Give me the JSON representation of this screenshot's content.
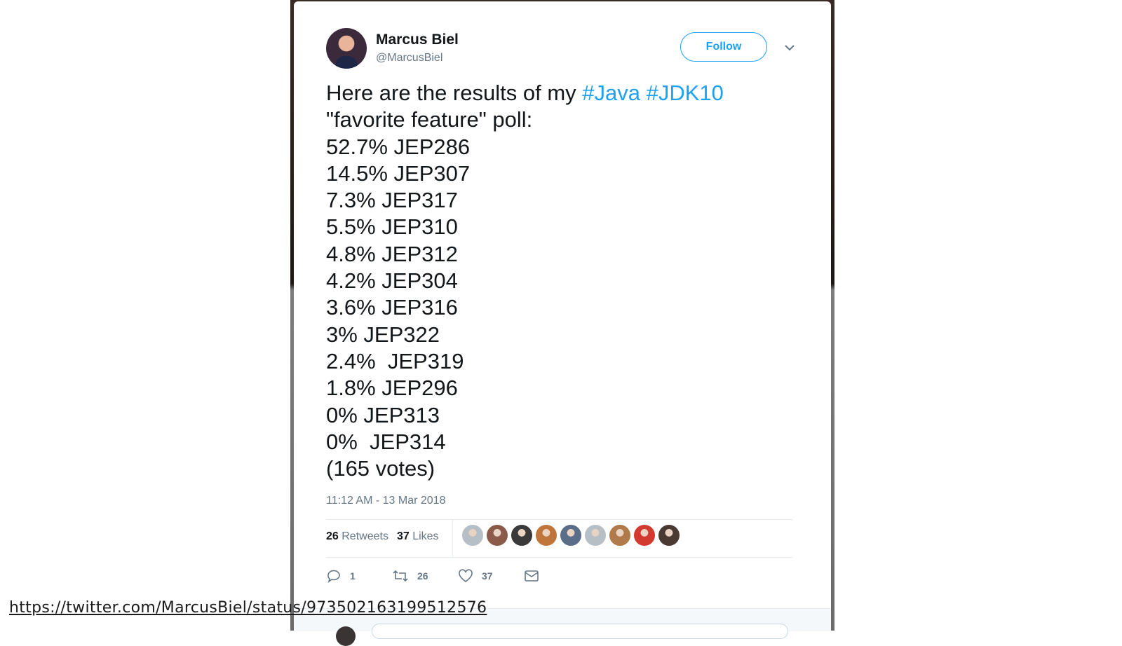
{
  "tweet": {
    "author_name": "Marcus Biel",
    "author_handle": "@MarcusBiel",
    "follow_label": "Follow",
    "intro": "Here are the results of my ",
    "hashtags": [
      "#Java",
      "#JDK10"
    ],
    "line2": "\"favorite feature\" poll:",
    "results": [
      "52.7% JEP286",
      "14.5% JEP307",
      "7.3% JEP317",
      "5.5% JEP310",
      "4.8% JEP312",
      "4.2% JEP304",
      "3.6% JEP316",
      "3% JEP322",
      "2.4%  JEP319",
      "1.8% JEP296",
      "0% JEP313",
      "0%  JEP314"
    ],
    "votes": "(165 votes)",
    "timestamp": "11:12 AM - 13 Mar 2018",
    "stats": {
      "retweets_count": "26",
      "retweets_label": "Retweets",
      "likes_count": "37",
      "likes_label": "Likes"
    },
    "liker_avatar_colors": [
      "#b7bfc6",
      "#8b5a4a",
      "#3a3a3a",
      "#c0763a",
      "#5a6e8a",
      "#b7bfc6",
      "#b07a4a",
      "#d23a30",
      "#4a3a32"
    ],
    "actions": {
      "reply_count": "1",
      "retweet_count": "26",
      "like_count": "37"
    }
  },
  "footer": {
    "url": "https://twitter.com/MarcusBiel/status/973502163199512576"
  },
  "colors": {
    "accent": "#1da1f2",
    "text": "#14171a",
    "muted": "#657786"
  }
}
